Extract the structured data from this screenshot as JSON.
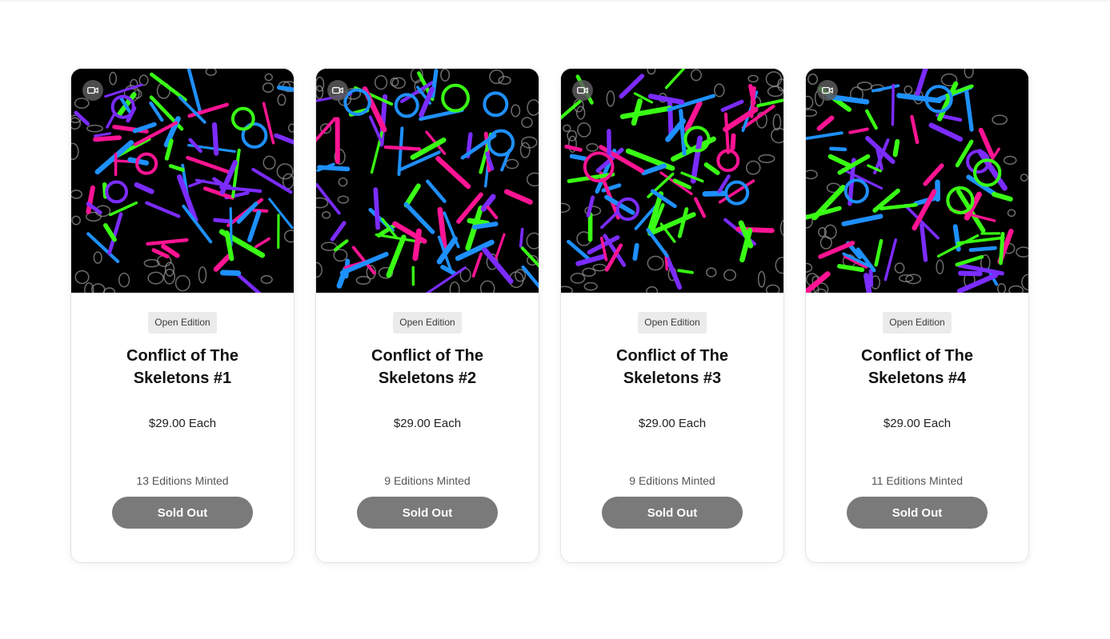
{
  "cards": [
    {
      "badge": "Open Edition",
      "title": "Conflict of The Skeletons #1",
      "price": "$29.00 Each",
      "minted": "13 Editions Minted",
      "button": "Sold Out"
    },
    {
      "badge": "Open Edition",
      "title": "Conflict of The Skeletons #2",
      "price": "$29.00 Each",
      "minted": "9 Editions Minted",
      "button": "Sold Out"
    },
    {
      "badge": "Open Edition",
      "title": "Conflict of The Skeletons #3",
      "price": "$29.00 Each",
      "minted": "9 Editions Minted",
      "button": "Sold Out"
    },
    {
      "badge": "Open Edition",
      "title": "Conflict of The Skeletons #4",
      "price": "$29.00 Each",
      "minted": "11 Editions Minted",
      "button": "Sold Out"
    }
  ],
  "icons": {
    "media_type": "video-camera-icon"
  },
  "colors": {
    "button_bg": "#7a7a7a",
    "badge_bg": "#ebebeb",
    "art_palette": [
      "#ff1493",
      "#7b2cff",
      "#1e90ff",
      "#39ff14",
      "#9a9a9a"
    ]
  }
}
